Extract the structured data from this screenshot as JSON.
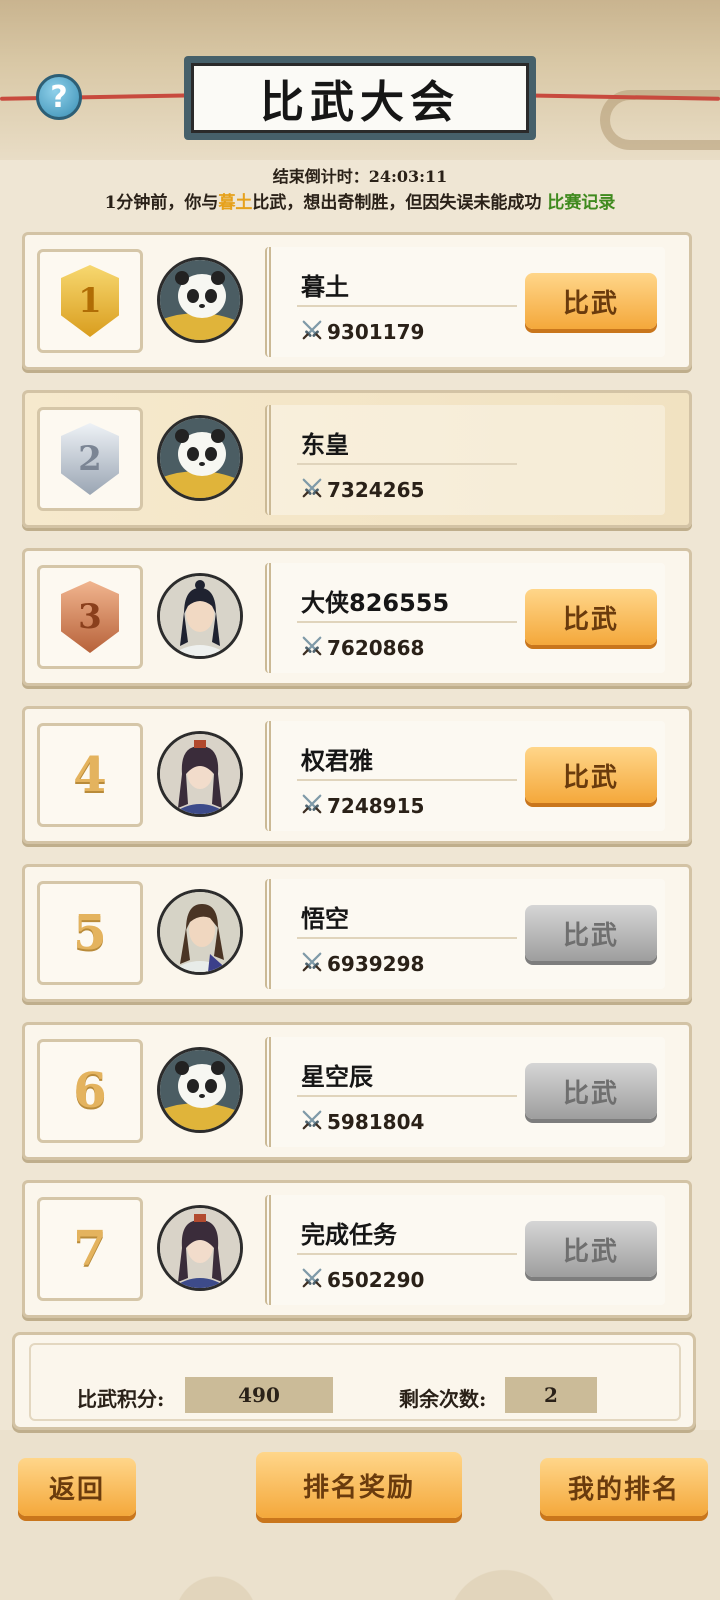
{
  "header": {
    "title": "比武大会",
    "help_icon": "?",
    "countdown_label": "结束倒计时：",
    "countdown_value": "24:03:11",
    "notice_prefix": "1分钟前，你与",
    "notice_opponent": "暮土",
    "notice_suffix": "比武，想出奇制胜，但因失误未能成功",
    "record_link": "比赛记录"
  },
  "players": [
    {
      "rank": "1",
      "medal": "gold",
      "name": "暮土",
      "power": "9301179",
      "button": "比武",
      "button_state": "active",
      "avatar": "panda",
      "highlight": false
    },
    {
      "rank": "2",
      "medal": "silver",
      "name": "东皇",
      "power": "7324265",
      "button": "",
      "button_state": "none",
      "avatar": "panda",
      "highlight": true
    },
    {
      "rank": "3",
      "medal": "bronze",
      "name": "大侠826555",
      "power": "7620868",
      "button": "比武",
      "button_state": "active",
      "avatar": "swordsman",
      "highlight": false
    },
    {
      "rank": "4",
      "medal": "none",
      "name": "权君雅",
      "power": "7248915",
      "button": "比武",
      "button_state": "active",
      "avatar": "lady",
      "highlight": false
    },
    {
      "rank": "5",
      "medal": "none",
      "name": "悟空",
      "power": "6939298",
      "button": "比武",
      "button_state": "disabled",
      "avatar": "scholar",
      "highlight": false
    },
    {
      "rank": "6",
      "medal": "none",
      "name": "星空辰",
      "power": "5981804",
      "button": "比武",
      "button_state": "disabled",
      "avatar": "panda",
      "highlight": false
    },
    {
      "rank": "7",
      "medal": "none",
      "name": "完成任务",
      "power": "6502290",
      "button": "比武",
      "button_state": "disabled",
      "avatar": "lady",
      "highlight": false
    }
  ],
  "stats": {
    "score_label": "比武积分:",
    "score_value": "490",
    "remaining_label": "剩余次数:",
    "remaining_value": "2"
  },
  "footer": {
    "back": "返回",
    "rank_reward": "排名奖励",
    "my_rank": "我的排名"
  },
  "icons": {
    "help": "question-icon",
    "power": "crossed-swords-icon"
  },
  "colors": {
    "button_active": "#f4a83b",
    "button_disabled": "#9e9e9e",
    "opponent_highlight": "#e6a11b",
    "record_link": "#3f8a1e"
  }
}
